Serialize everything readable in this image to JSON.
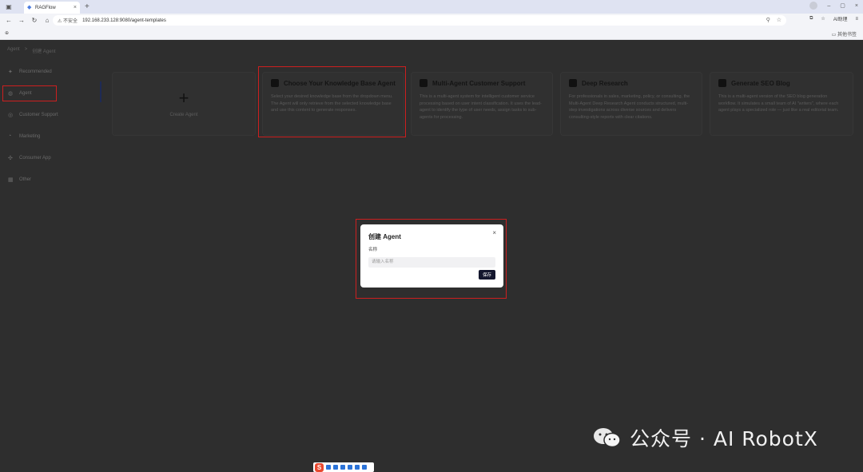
{
  "browser": {
    "tab_title": "RAGFlow",
    "url": "192.168.233.128:9080/agent-templates",
    "insecure_label": "不安全",
    "ai_label": "AI助理",
    "bookmarks_right": "其他书签"
  },
  "breadcrumb": {
    "root": "Agent",
    "separator": ">",
    "current": "创建 Agent"
  },
  "sidebar": {
    "items": [
      {
        "label": "Recommended",
        "icon": "star-icon"
      },
      {
        "label": "Agent",
        "icon": "agent-icon"
      },
      {
        "label": "Customer Support",
        "icon": "support-icon"
      },
      {
        "label": "Marketing",
        "icon": "marketing-icon"
      },
      {
        "label": "Consumer App",
        "icon": "app-icon"
      },
      {
        "label": "Other",
        "icon": "grid-icon"
      }
    ]
  },
  "create_card": {
    "label": "Create Agent"
  },
  "templates": [
    {
      "title": "Choose Your Knowledge Base Agent",
      "description": "Select your desired knowledge base from the dropdown menu. The Agent will only retrieve from the selected knowledge base and use this content to generate responses."
    },
    {
      "title": "Multi-Agent Customer Support",
      "description": "This is a multi-agent system for intelligent customer service processing based on user intent classification. It uses the lead-agent to identify the type of user needs, assign tasks to sub-agents for processing."
    },
    {
      "title": "Deep Research",
      "description": "For professionals in sales, marketing, policy, or consulting, the Multi-Agent Deep Research Agent conducts structured, multi-step investigations across diverse sources and delivers consulting-style reports with clear citations."
    },
    {
      "title": "Generate SEO Blog",
      "description": "This is a multi-agent version of the SEO blog generation workflow. It simulates a small team of AI \"writers\", where each agent plays a specialized role — just like a real editorial team."
    }
  ],
  "modal": {
    "title": "创建 Agent",
    "name_label": "名称",
    "name_placeholder": "请输入名称",
    "save_label": "保存",
    "close_glyph": "×"
  },
  "watermark": {
    "text": "公众号 · AI RobotX"
  },
  "ime": {
    "logo": "S"
  }
}
